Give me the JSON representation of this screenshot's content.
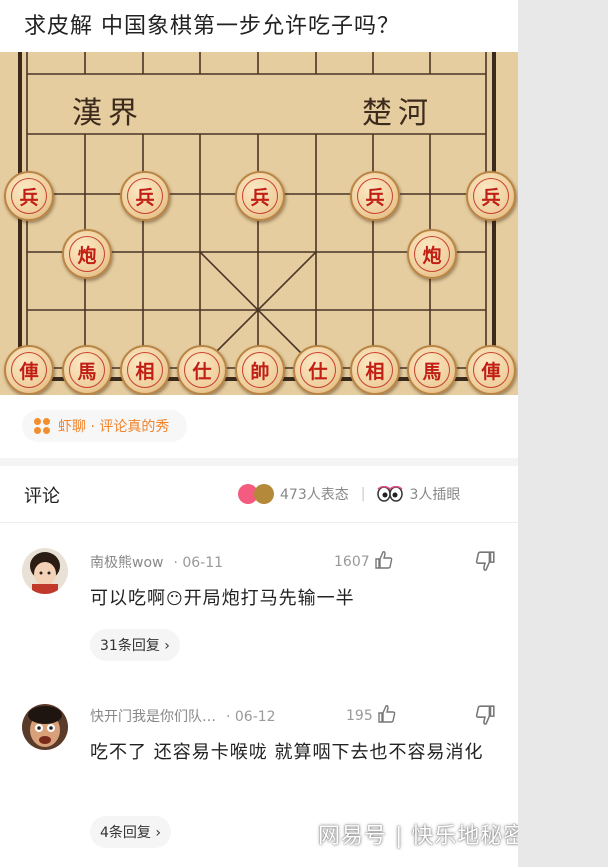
{
  "post": {
    "title": "求皮解 中国象棋第一步允许吃子吗？"
  },
  "board": {
    "river_left": "漢界",
    "river_right": "楚河",
    "pawns": [
      "兵",
      "兵",
      "兵",
      "兵",
      "兵"
    ],
    "cannons": [
      "炮",
      "炮"
    ],
    "back_rank": [
      "俥",
      "馬",
      "相",
      "仕",
      "帥",
      "仕",
      "相",
      "馬",
      "俥"
    ]
  },
  "source": {
    "label": "虾聊 · 评论真的秀"
  },
  "comments_header": {
    "title": "评论",
    "reactions_text": "473人表态",
    "watching_text": "3人插眼"
  },
  "comments": [
    {
      "username": "南极熊wow",
      "date": "· 06-11",
      "likes": "1607",
      "text_before_emoji": "可以吃啊",
      "emoji": "😶",
      "text_after_emoji": "开局炮打马先输一半",
      "replies": "31条回复 ›"
    },
    {
      "username": "快开门我是你们队…",
      "date": "· 06-12",
      "likes": "195",
      "text": "吃不了  还容易卡喉咙  就算咽下去也不容易消化",
      "replies": "4条回复 ›"
    }
  ],
  "watermark": "网易号 | 快乐地秘密",
  "colors": {
    "accent": "#f0832a",
    "piece_red": "#c21f14",
    "board": "#e5cd9f"
  }
}
